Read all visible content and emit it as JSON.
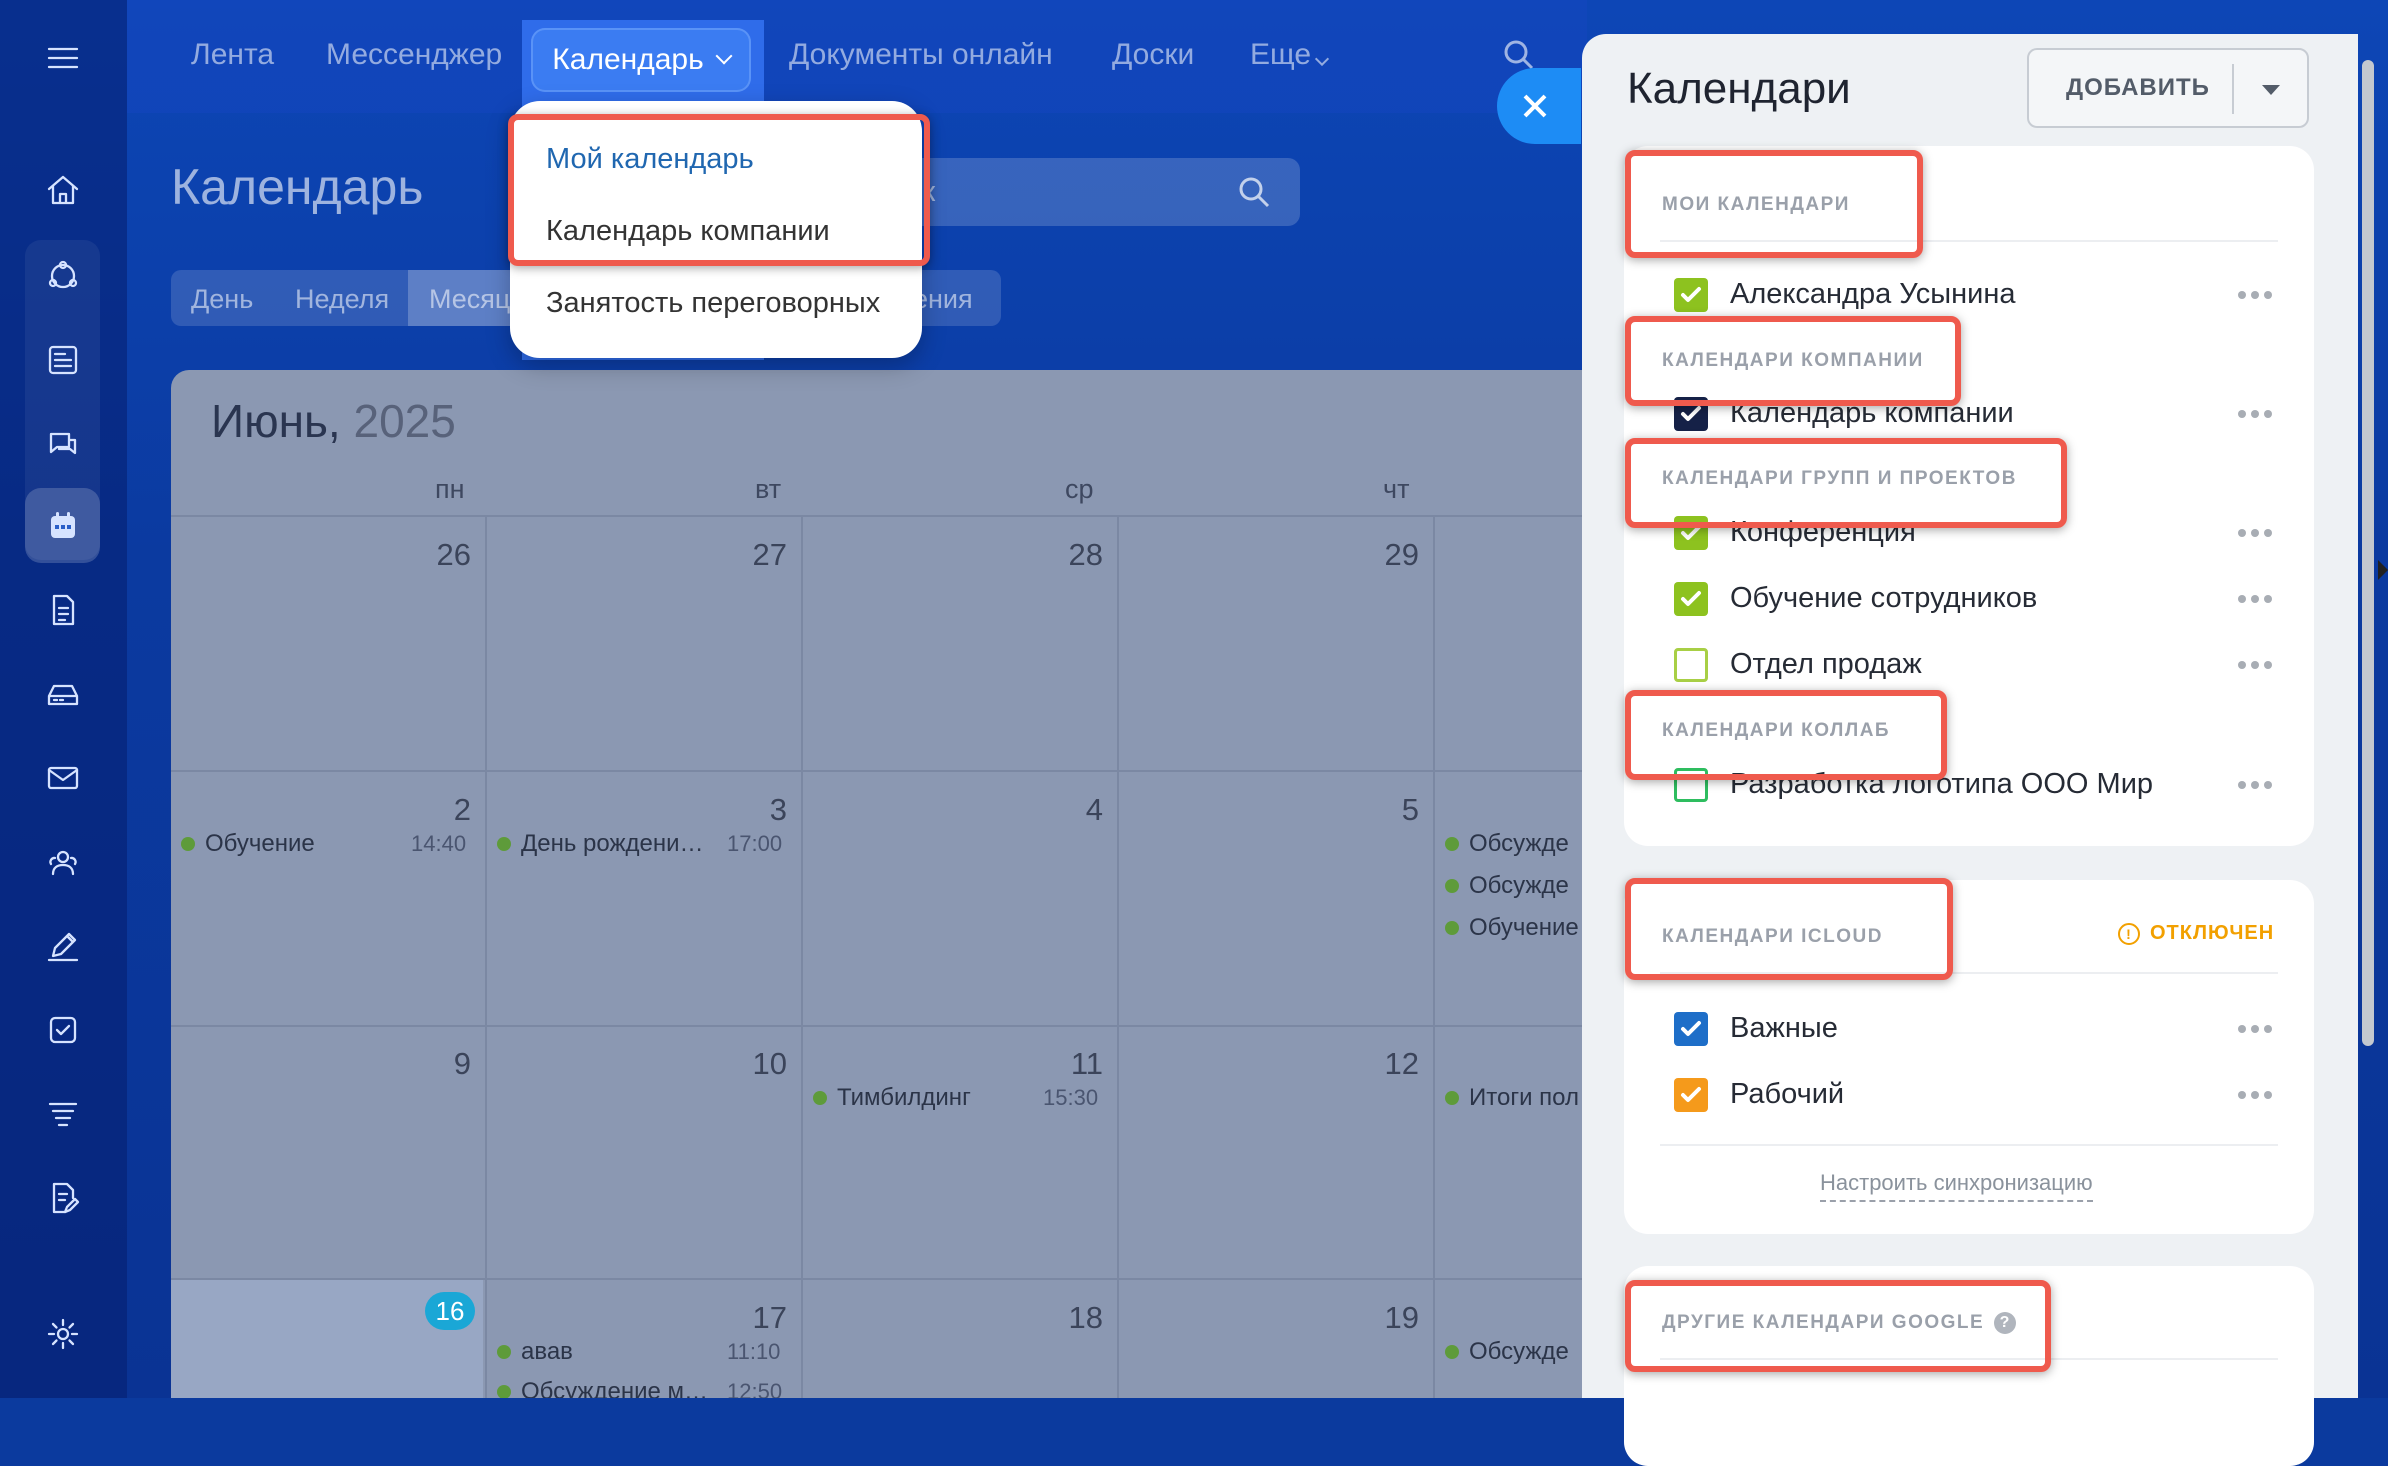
{
  "nav": {
    "items": [
      "Лента",
      "Мессенджер",
      "Календарь",
      "Документы онлайн",
      "Доски",
      "Еще"
    ]
  },
  "dropdown": {
    "items": [
      "Мой календарь",
      "Календарь компании",
      "Занятость переговорных"
    ]
  },
  "page": {
    "title": "Календарь",
    "search_placeholder": "ск"
  },
  "view_tabs": [
    "День",
    "Неделя",
    "Месяц",
    "ения"
  ],
  "calendar": {
    "month": "Июнь,",
    "year": "2025",
    "weekdays": [
      "пн",
      "вт",
      "ср",
      "чт"
    ],
    "rows": [
      {
        "days": [
          "26",
          "27",
          "28",
          "29"
        ]
      },
      {
        "days": [
          "2",
          "3",
          "4",
          "5"
        ]
      },
      {
        "days": [
          "9",
          "10",
          "11",
          "12"
        ]
      },
      {
        "days": [
          "16",
          "17",
          "18",
          "19"
        ]
      }
    ],
    "events": {
      "e1": {
        "title": "Обучение",
        "time": "14:40"
      },
      "e2": {
        "title": "День рождени…",
        "time": "17:00"
      },
      "e3": {
        "title": "Обсужде"
      },
      "e4": {
        "title": "Обсужде"
      },
      "e5": {
        "title": "Обучение"
      },
      "e6": {
        "title": "Тимбилдинг",
        "time": "15:30"
      },
      "e7": {
        "title": "Итоги пол"
      },
      "e8": {
        "title": "авав",
        "time": "11:10"
      },
      "e9": {
        "title": "Обсуждение м…",
        "time": "12:50"
      },
      "e10": {
        "title": "Обсужде"
      }
    },
    "today_color": "#1aa7d6",
    "event_dot_color": "#5e9b3a"
  },
  "panel": {
    "title": "Календари",
    "add_label": "ДОБАВИТЬ",
    "sections": {
      "my": "МОИ КАЛЕНДАРИ",
      "company": "КАЛЕНДАРИ КОМПАНИИ",
      "groups": "КАЛЕНДАРИ ГРУПП И ПРОЕКТОВ",
      "collab": "КАЛЕНДАРИ КОЛЛАБ",
      "icloud": "КАЛЕНДАРИ ICLOUD",
      "google": "ДРУГИЕ КАЛЕНДАРИ GOOGLE"
    },
    "calendars": {
      "c1": {
        "name": "Александра Усынина",
        "color": "#8dc21f",
        "checked": true
      },
      "c2": {
        "name": "Календарь компании",
        "color": "#152147",
        "checked": true
      },
      "c3": {
        "name": "Конференция",
        "color": "#8dc21f",
        "checked": true
      },
      "c4": {
        "name": "Обучение сотрудников",
        "color": "#8dc21f",
        "checked": true
      },
      "c5": {
        "name": "Отдел продаж",
        "color": "#a8cf45",
        "checked": false
      },
      "c6": {
        "name": "Разработка логотипа ООО Мир",
        "color": "#2ebd5f",
        "checked": false
      },
      "c7": {
        "name": "Важные",
        "color": "#1e6ec8",
        "checked": true
      },
      "c8": {
        "name": "Рабочий",
        "color": "#f59a1b",
        "checked": true
      }
    },
    "icloud_status": "ОТКЛЮЧЕН",
    "sync_link": "Настроить синхронизацию"
  },
  "colors": {
    "highlight": "#ef5a4d",
    "accent": "#3b7cf2",
    "warning": "#f2a000"
  }
}
